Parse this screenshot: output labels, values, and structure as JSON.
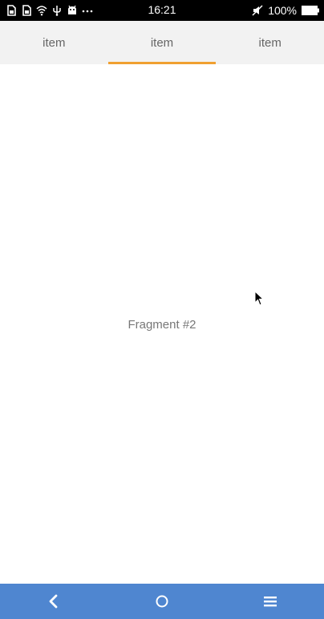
{
  "status_bar": {
    "time": "16:21",
    "battery": "100%",
    "left_icons": [
      "sim-card-icon",
      "sim-card-icon",
      "wifi-icon",
      "usb-icon",
      "android-icon",
      "more-dots-icon"
    ],
    "right_icons": [
      "mute-icon",
      "battery-icon"
    ]
  },
  "tabs": [
    {
      "label": "item",
      "selected": false
    },
    {
      "label": "item",
      "selected": true
    },
    {
      "label": "item",
      "selected": false
    }
  ],
  "content": {
    "fragment_label": "Fragment #2"
  },
  "nav_bar": {
    "buttons": [
      "back-icon",
      "home-icon",
      "menu-icon"
    ]
  },
  "colors": {
    "status_bar": "#000000",
    "tab_bar": "#f2f2f2",
    "tab_indicator": "#f0a030",
    "nav_bar": "#4f86d0",
    "text": "#777777"
  }
}
